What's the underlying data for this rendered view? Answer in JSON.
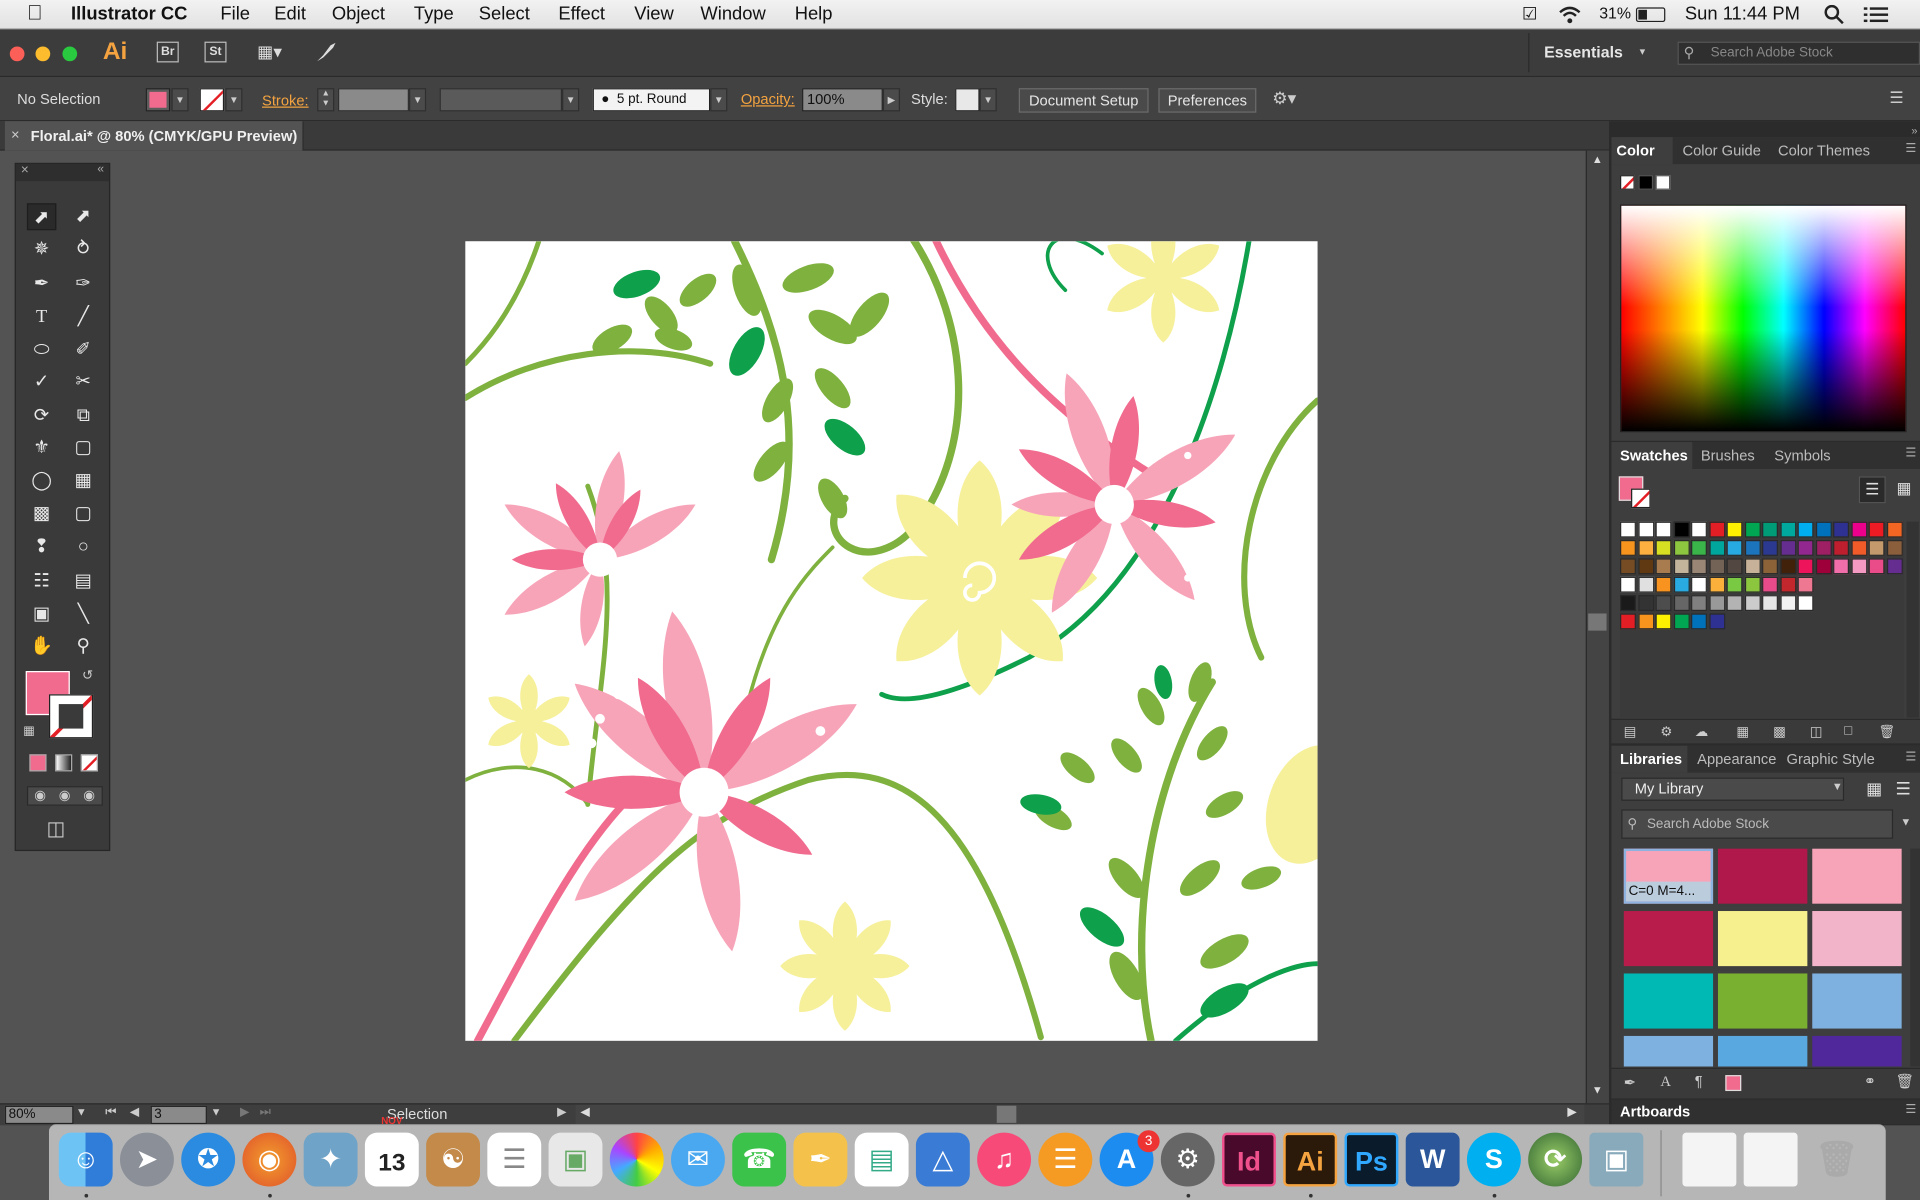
{
  "menubar": {
    "app_name": "Illustrator CC",
    "menus": [
      "File",
      "Edit",
      "Object",
      "Type",
      "Select",
      "Effect",
      "View",
      "Window",
      "Help"
    ],
    "battery": "31%",
    "clock": "Sun 11:44 PM"
  },
  "appbar": {
    "ai_logo": "Ai",
    "br": "Br",
    "st": "St",
    "workspace": "Essentials",
    "search_placeholder": "Search Adobe Stock"
  },
  "control": {
    "selection": "No Selection",
    "stroke_label": "Stroke:",
    "brush": "5 pt. Round",
    "opacity_label": "Opacity:",
    "opacity_value": "100%",
    "style_label": "Style:",
    "doc_setup": "Document Setup",
    "preferences": "Preferences"
  },
  "document": {
    "tab_title": "Floral.ai* @ 80% (CMYK/GPU Preview)"
  },
  "statusbar": {
    "zoom": "80%",
    "artboard_num": "3",
    "tool_name": "Selection"
  },
  "color_panel": {
    "tabs": [
      "Color",
      "Color Guide",
      "Color Themes"
    ]
  },
  "swatches_panel": {
    "tabs": [
      "Swatches",
      "Brushes",
      "Symbols"
    ],
    "rows": [
      [
        "#ffffff",
        "#ffffff",
        "#ffffff",
        "#000000",
        "#ffffff",
        "#e31e24",
        "#fff200",
        "#00a651",
        "#009b77",
        "#00a99d",
        "#00aeef",
        "#0072bc",
        "#2e3192",
        "#ec008c",
        "#ed1c24",
        "#f26522"
      ],
      [
        "#f7941d",
        "#fbb040",
        "#d7df23",
        "#8dc63f",
        "#39b54a",
        "#00a79d",
        "#27aae1",
        "#1c75bc",
        "#2b3990",
        "#662d91",
        "#92278f",
        "#9e1f63",
        "#be1e2d",
        "#f15a29",
        "#c49a6c",
        "#8b5e3c"
      ],
      [
        "#754c24",
        "#603913",
        "#a97c50",
        "#c2b59b",
        "#998675",
        "#736357",
        "#534741",
        "#c7b299",
        "#8c6239",
        "#42210b",
        "#ed145b",
        "#9e0039",
        "#f06eaa",
        "#f49ac2",
        "#ea4c89",
        "#662d91"
      ],
      [
        "#ffffff",
        "#e0e0e0",
        "#f7931e",
        "#29abe2",
        "#ffffff",
        "#fbb03b",
        "#7ac943",
        "#8cc63f",
        "#e84b8a",
        "#c1272d",
        "#ee7791"
      ],
      [
        "#1a1a1a",
        "#333333",
        "#4d4d4d",
        "#666666",
        "#808080",
        "#999999",
        "#b3b3b3",
        "#cccccc",
        "#e6e6e6",
        "#f2f2f2",
        "#ffffff"
      ],
      [
        "#e31e24",
        "#f7941d",
        "#fff200",
        "#00a651",
        "#0072bc",
        "#2e3192"
      ]
    ]
  },
  "libraries_panel": {
    "tabs": [
      "Libraries",
      "Appearance",
      "Graphic Style"
    ],
    "library_name": "My Library",
    "search_placeholder": "Search Adobe Stock",
    "first_swatch_label": "C=0 M=4...",
    "colors": [
      "#f7a4b9",
      "#b0174a",
      "#f7a4b9",
      "#b81c4a",
      "#f6f08e",
      "#f2b4c8",
      "#00b8b4",
      "#7ab02f",
      "#7fb1e0",
      "#7fb1e0",
      "#59a8e0",
      "#50289b"
    ]
  },
  "artboards_panel": {
    "title": "Artboards"
  },
  "dock": {
    "calendar_month": "NOV",
    "calendar_day": "13",
    "appstore_badge": "3",
    "id_label": "Id",
    "ai_label": "Ai",
    "ps_label": "Ps",
    "w_label": "W",
    "s_label": "S"
  },
  "colors": {
    "fill": "#f06b8e",
    "accent_orange": "#f4a340",
    "pink_dark": "#f06b8e",
    "pink_light": "#f7a4b9",
    "leaf_green": "#7fb13f",
    "dark_green": "#0ea04b",
    "yellow": "#f6f09a"
  }
}
